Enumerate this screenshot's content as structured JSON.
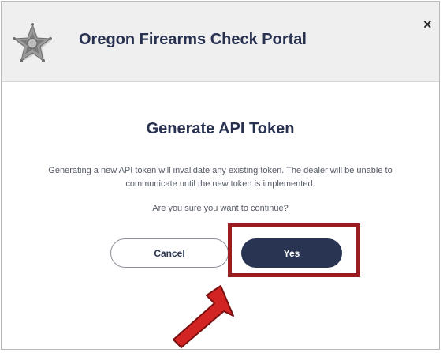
{
  "header": {
    "portal_title": "Oregon Firearms Check Portal",
    "close_glyph": "×",
    "logo_icon": "sheriff-star-badge-icon"
  },
  "dialog": {
    "title": "Generate API Token",
    "message": "Generating a new API token will invalidate any existing token. The dealer will be unable to communicate until the new token is implemented.",
    "confirm_question": "Are you sure you want to continue?"
  },
  "buttons": {
    "cancel_label": "Cancel",
    "yes_label": "Yes"
  },
  "annotation": {
    "highlight_color": "#9b1c1e",
    "arrow_color": "#d32424",
    "arrow_icon": "pointer-arrow-icon"
  },
  "colors": {
    "brand_navy": "#283452",
    "header_bg": "#efefef"
  }
}
